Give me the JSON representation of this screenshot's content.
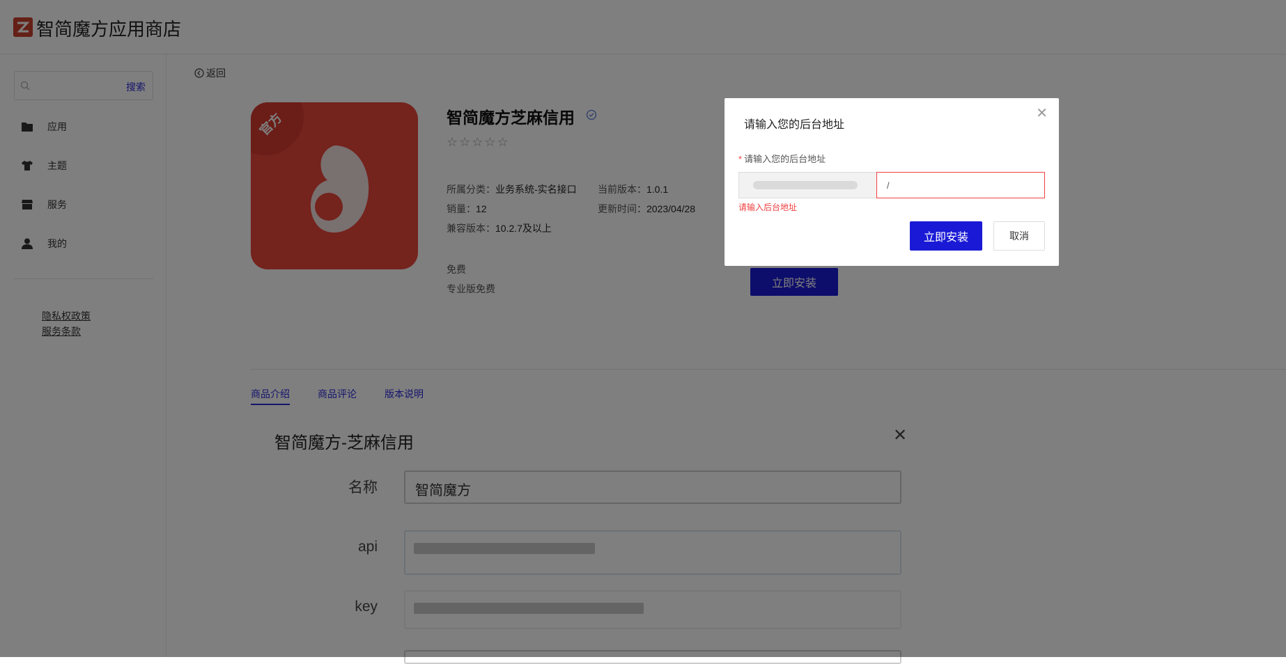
{
  "header": {
    "title": "智简魔方应用商店"
  },
  "sidebar": {
    "search": {
      "placeholder": "",
      "button": "搜索"
    },
    "items": [
      {
        "label": "应用",
        "icon": "folder-icon"
      },
      {
        "label": "主题",
        "icon": "shirt-icon"
      },
      {
        "label": "服务",
        "icon": "store-icon"
      },
      {
        "label": "我的",
        "icon": "user-icon"
      }
    ],
    "links": [
      "隐私权政策",
      "服务条款"
    ]
  },
  "main": {
    "back": "返回",
    "app": {
      "badge": "官方",
      "name": "智简魔方芝麻信用",
      "rating_stars": "☆☆☆☆☆",
      "category_label": "所属分类：",
      "category": "业务系统-实名接口",
      "version_label": "当前版本：",
      "version": "1.0.1",
      "sales_label": "销量：",
      "sales": "12",
      "updated_label": "更新时间：",
      "updated": "2023/04/28",
      "compat_label": "兼容版本：",
      "compat": "10.2.7及以上",
      "price": "免费",
      "pro_price": "专业版免费",
      "install": "立即安装"
    },
    "tabs": [
      "商品介绍",
      "商品评论",
      "版本说明"
    ],
    "screenshot": {
      "title": "智简魔方-芝麻信用",
      "close": "✕",
      "fields": [
        {
          "label": "名称",
          "value": "智简魔方"
        },
        {
          "label": "api",
          "value": ""
        },
        {
          "label": "key",
          "value": ""
        }
      ]
    }
  },
  "dialog": {
    "title": "请输入您的后台地址",
    "close": "✕",
    "field_label": "请输入您的后台地址",
    "required_mark": "*",
    "input_value": "/",
    "error": "请输入后台地址",
    "install": "立即安装",
    "cancel": "取消"
  },
  "colors": {
    "accent": "#1a1ad6",
    "brand": "#e8473b",
    "error": "#f04040"
  }
}
